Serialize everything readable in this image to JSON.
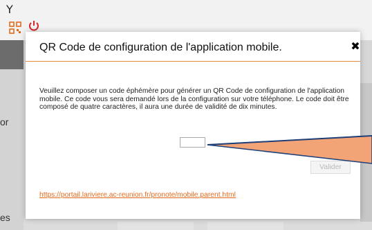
{
  "background": {
    "header_letter": "Y",
    "left_text_1": "or",
    "left_text_2": "es"
  },
  "icons": {
    "qr": "qr-code-icon",
    "power": "power-icon",
    "close": "close-icon"
  },
  "colors": {
    "accent": "#e08a3a",
    "link": "#e36a1b",
    "callout_fill": "#f2a477",
    "callout_stroke": "#1e3f78"
  },
  "modal": {
    "title": "QR Code de configuration de l'application mobile.",
    "close_glyph": "✖",
    "description": "Veuillez composer un code éphémère pour générer un QR Code de configuration de l'application mobile. Ce code vous sera demandé lors de la configuration sur votre téléphone. Le code doit être composé de quatre caractères, il aura une durée de validité de dix minutes.",
    "code_value": "",
    "validate_label": "Valider",
    "link_text": "https://portail.lariviere.ac-reunion.fr/pronote/mobile.parent.html"
  }
}
